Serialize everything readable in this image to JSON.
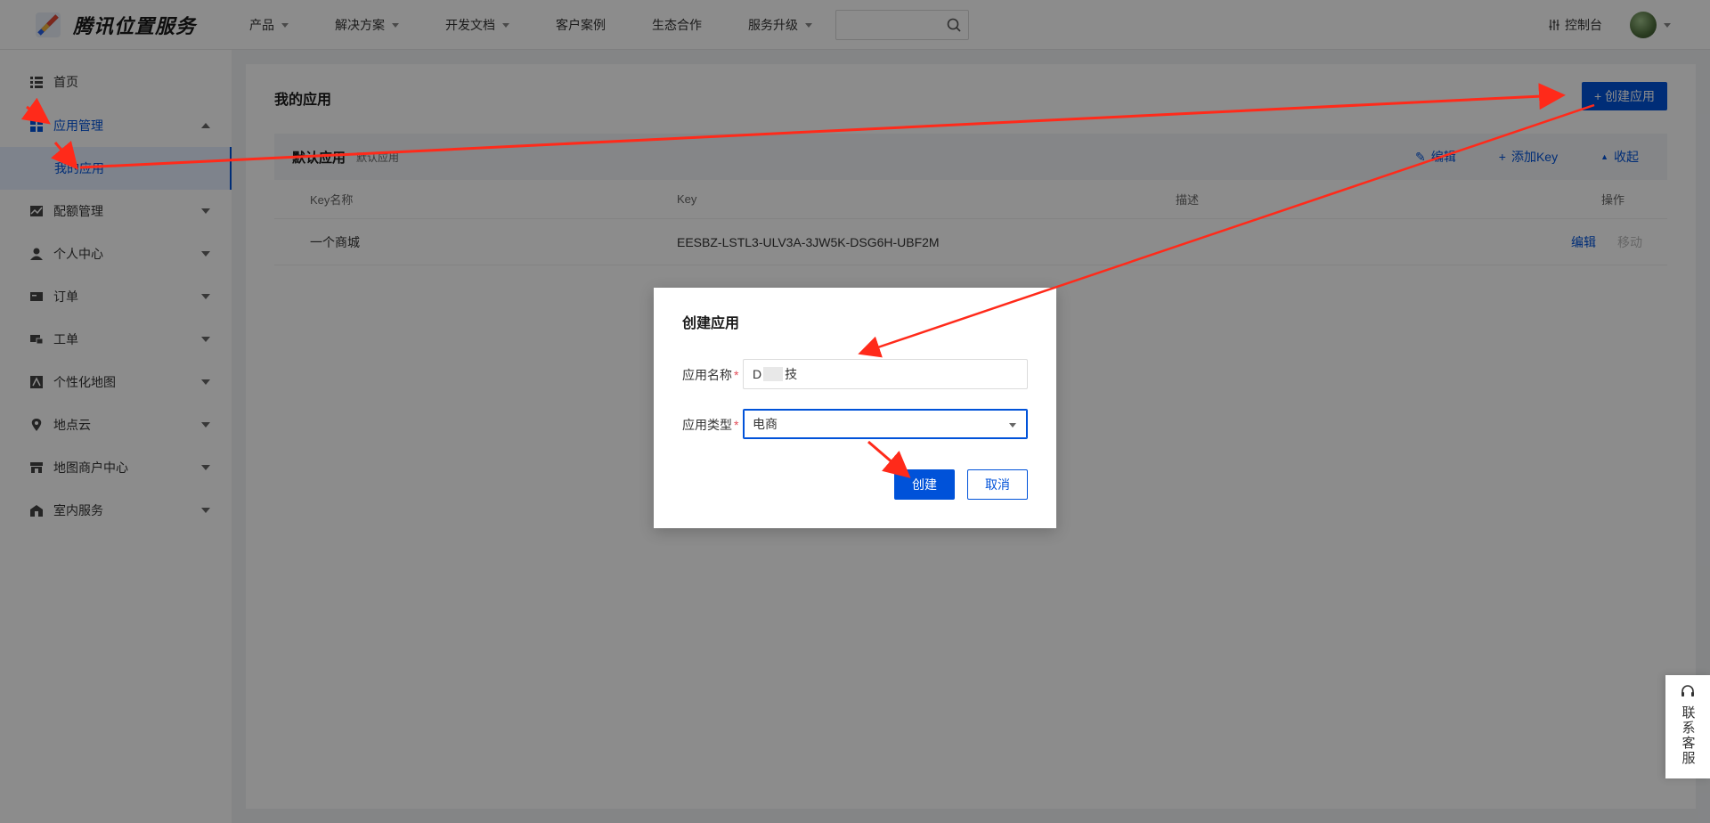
{
  "header": {
    "logo_text": "腾讯位置服务",
    "nav": [
      {
        "label": "产品",
        "dropdown": true
      },
      {
        "label": "解决方案",
        "dropdown": true
      },
      {
        "label": "开发文档",
        "dropdown": true
      },
      {
        "label": "客户案例",
        "dropdown": false
      },
      {
        "label": "生态合作",
        "dropdown": false
      },
      {
        "label": "服务升级",
        "dropdown": true
      }
    ],
    "search_placeholder": "",
    "console_label": "控制台"
  },
  "sidebar": {
    "items": [
      {
        "label": "首页",
        "icon": "list-icon"
      },
      {
        "label": "应用管理",
        "icon": "grid-icon"
      },
      {
        "label": "我的应用"
      },
      {
        "label": "配额管理",
        "icon": "chart-icon"
      },
      {
        "label": "个人中心",
        "icon": "user-icon"
      },
      {
        "label": "订单",
        "icon": "card-icon"
      },
      {
        "label": "工单",
        "icon": "ticket-icon"
      },
      {
        "label": "个性化地图",
        "icon": "map-style-icon"
      },
      {
        "label": "地点云",
        "icon": "location-icon"
      },
      {
        "label": "地图商户中心",
        "icon": "store-icon"
      },
      {
        "label": "室内服务",
        "icon": "building-icon"
      }
    ]
  },
  "main": {
    "title": "我的应用",
    "create_button": "+ 创建应用",
    "app": {
      "name": "默认应用",
      "subtitle": "默认应用",
      "actions": {
        "edit": "编辑",
        "add_key": "添加Key",
        "collapse": "收起"
      },
      "columns": [
        "Key名称",
        "Key",
        "描述",
        "操作"
      ],
      "rows": [
        {
          "name": "一个商城",
          "key": "EESBZ-LSTL3-ULV3A-3JW5K-DSG6H-UBF2M",
          "desc": "",
          "op_edit": "编辑",
          "op_move": "移动"
        }
      ]
    }
  },
  "dialog": {
    "title": "创建应用",
    "name_label": "应用名称",
    "name_prefix": "D",
    "name_suffix": "技",
    "type_label": "应用类型",
    "type_value": "电商",
    "confirm": "创建",
    "cancel": "取消"
  },
  "support": {
    "label": "联系客服"
  },
  "colors": {
    "primary": "#0052d9",
    "annotation": "#ff2a1a"
  }
}
